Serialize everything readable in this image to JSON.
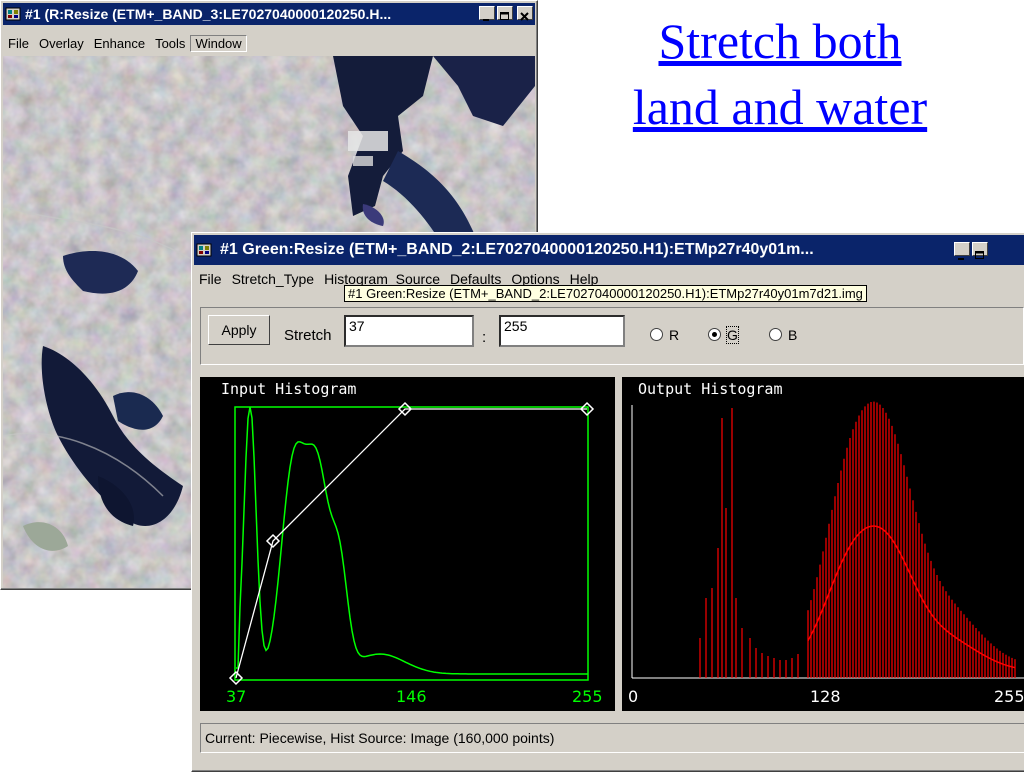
{
  "slide": {
    "title_line1": "Stretch both",
    "title_line2": "land and water"
  },
  "back_window": {
    "title": "#1 (R:Resize (ETM+_BAND_3:LE7027040000120250.H...",
    "menu": [
      "File",
      "Overlay",
      "Enhance",
      "Tools",
      "Window"
    ]
  },
  "front_window": {
    "title": "#1 Green:Resize (ETM+_BAND_2:LE7027040000120250.H1):ETMp27r40y01m...",
    "menu": [
      "File",
      "Stretch_Type",
      "Histogram_Source",
      "Defaults",
      "Options",
      "Help"
    ],
    "tooltip": "#1 Green:Resize (ETM+_BAND_2:LE7027040000120250.H1):ETMp27r40y01m7d21.img",
    "apply_label": "Apply",
    "stretch_label": "Stretch",
    "stretch_min": "37",
    "stretch_sep": ":",
    "stretch_max": "255",
    "radios": [
      {
        "label": "R",
        "checked": false
      },
      {
        "label": "G",
        "checked": true
      },
      {
        "label": "B",
        "checked": false
      }
    ],
    "input_hist": {
      "title": "Input Histogram",
      "ticks": [
        "37",
        "146",
        "255"
      ],
      "color": "#00ff00"
    },
    "output_hist": {
      "title": "Output Histogram",
      "ticks": [
        "0",
        "128",
        "255"
      ],
      "color": "#ff0000"
    },
    "status": "Current: Piecewise, Hist Source: Image (160,000 points)"
  }
}
